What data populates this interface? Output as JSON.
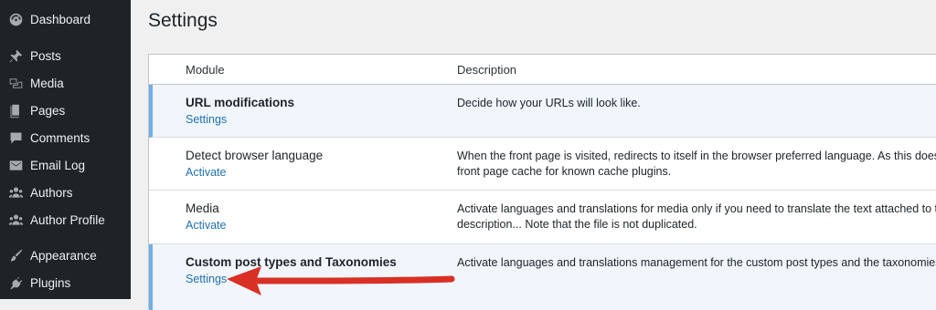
{
  "sidebar": {
    "items": [
      {
        "label": "Dashboard",
        "icon": "dashboard-icon"
      },
      {
        "label": "Posts",
        "icon": "pin-icon"
      },
      {
        "label": "Media",
        "icon": "media-icon"
      },
      {
        "label": "Pages",
        "icon": "pages-icon"
      },
      {
        "label": "Comments",
        "icon": "comments-icon"
      },
      {
        "label": "Email Log",
        "icon": "email-icon"
      },
      {
        "label": "Authors",
        "icon": "users-icon"
      },
      {
        "label": "Author Profile",
        "icon": "users-icon"
      },
      {
        "label": "Appearance",
        "icon": "paintbrush-icon"
      },
      {
        "label": "Plugins",
        "icon": "plugins-icon"
      }
    ]
  },
  "page": {
    "title": "Settings"
  },
  "table": {
    "headers": {
      "module": "Module",
      "description": "Description"
    },
    "rows": [
      {
        "name": "URL modifications",
        "action": "Settings",
        "active": true,
        "description": [
          "Decide how your URLs will look like."
        ]
      },
      {
        "name": "Detect browser language",
        "action": "Activate",
        "active": false,
        "description": [
          "When the front page is visited, redirects to itself in the browser preferred language. As this doesn't",
          "front page cache for known cache plugins."
        ]
      },
      {
        "name": "Media",
        "action": "Activate",
        "active": false,
        "description": [
          "Activate languages and translations for media only if you need to translate the text attached to the",
          "description... Note that the file is not duplicated."
        ]
      },
      {
        "name": "Custom post types and Taxonomies",
        "action": "Settings",
        "active": true,
        "description": [
          "Activate languages and translations management for the custom post types and the taxonomies."
        ]
      }
    ]
  },
  "colors": {
    "sidebar_bg": "#1d2327",
    "link": "#2271b1",
    "active_border": "#72aee6",
    "active_row_bg": "#f0f6fc",
    "annotation_arrow": "#d93025"
  }
}
